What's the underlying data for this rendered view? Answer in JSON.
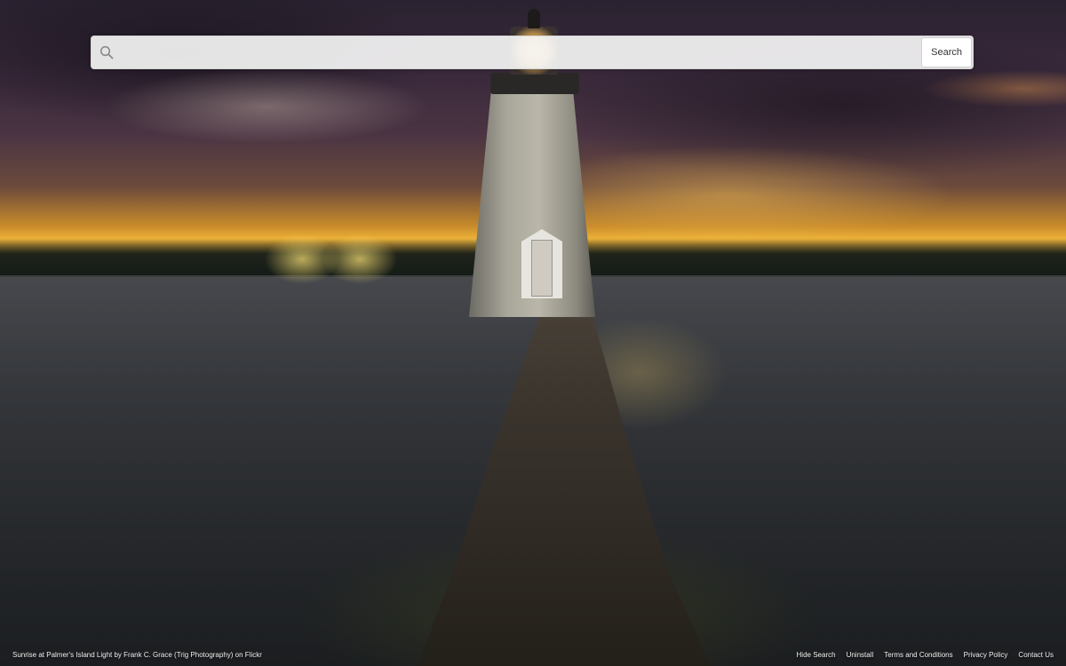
{
  "search": {
    "value": "",
    "placeholder": "",
    "button_label": "Search"
  },
  "footer": {
    "credit": "Sunrise at Palmer's Island Light by Frank C. Grace (Trig Photography) on Flickr",
    "links": {
      "hide_search": "Hide Search",
      "uninstall": "Uninstall",
      "terms": "Terms and Conditions",
      "privacy": "Privacy Policy",
      "contact": "Contact Us"
    }
  },
  "icons": {
    "search": "search-icon"
  },
  "colors": {
    "search_bar_bg": "#f5f5f5",
    "button_bg": "#ffffff",
    "footer_text": "#f2f2f2"
  }
}
